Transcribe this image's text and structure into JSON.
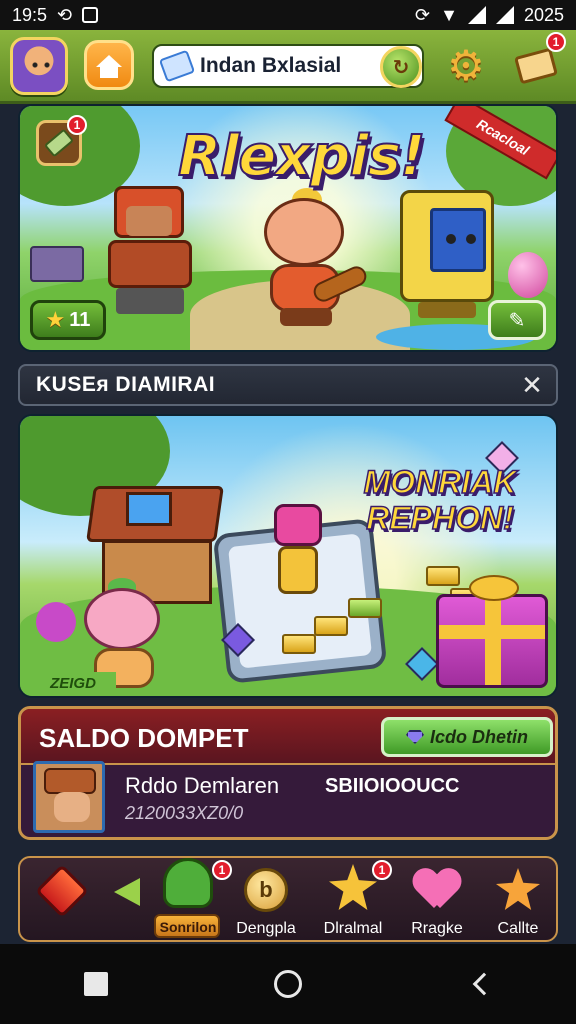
{
  "status_bar": {
    "time": "19:5",
    "clock": "2025"
  },
  "top_bar": {
    "search_text": "Indan Bxlasial",
    "mail_badge": "1"
  },
  "hero": {
    "title": "Rlexpis!",
    "ribbon": "Rcacloal",
    "counter": "11",
    "icon_badge": "1"
  },
  "notice": {
    "text": "KUSEᴙ DIAMIRAI",
    "close": "✕"
  },
  "promo": {
    "title_line1": "MONRIAK",
    "title_line2": "REPHON!",
    "label": "ZEIGD"
  },
  "wallet": {
    "title": "SALDO DOMPET",
    "button": "Icdo Dhetin",
    "name": "Rddo Demlaren",
    "sub": "2120033XZ0/0",
    "value": "SBIIOIOOUCC"
  },
  "bottom_nav": {
    "items": [
      {
        "label": "",
        "icon": "red-gem-icon",
        "badge": ""
      },
      {
        "label": "",
        "icon": "arrow-left-icon",
        "badge": ""
      },
      {
        "label": "Sonrilon",
        "icon": "green-character-icon",
        "badge": "1",
        "active": true
      },
      {
        "label": "Dengpla",
        "icon": "coin-icon",
        "badge": ""
      },
      {
        "label": "Dlralmal",
        "icon": "star-icon",
        "badge": "1"
      },
      {
        "label": "Rragke",
        "icon": "heart-icon",
        "badge": ""
      },
      {
        "label": "Callte",
        "icon": "orange-star-icon",
        "badge": ""
      }
    ]
  }
}
